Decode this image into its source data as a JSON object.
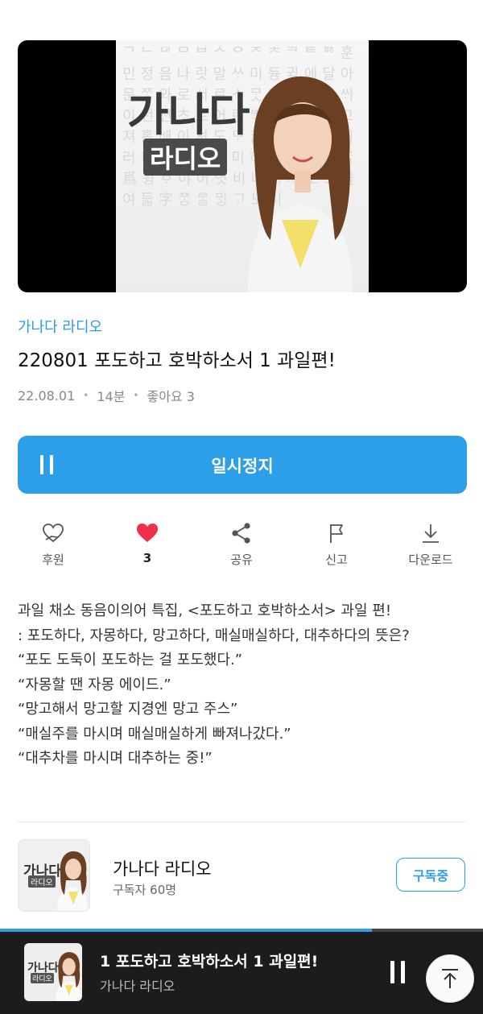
{
  "episode": {
    "artwork": {
      "title": "가나다",
      "subtitle": "라디오"
    },
    "channel_link": "가나다 라디오",
    "title": "220801 포도하고 호박하소서 1 과일편!",
    "date": "22.08.01",
    "duration": "14분",
    "likes_text": "좋아요 3"
  },
  "play_button": {
    "label": "일시정지",
    "icon": "pause-icon"
  },
  "actions": [
    {
      "label": "후원",
      "icon": "donate-heart-hand-icon"
    },
    {
      "label": "3",
      "icon": "heart-filled-icon"
    },
    {
      "label": "공유",
      "icon": "share-icon"
    },
    {
      "label": "신고",
      "icon": "flag-icon"
    },
    {
      "label": "다운로드",
      "icon": "download-icon"
    }
  ],
  "description": [
    "과일 채소 동음이의어 특집, <포도하고 호박하소서> 과일 편!",
    ":  포도하다, 자몽하다, 망고하다, 매실매실하다, 대추하다의 뜻은?",
    "“포도 도둑이 포도하는 걸 포도했다.”",
    "“자몽할 땐 자몽 에이드.”",
    "“망고해서 망고할 지경엔 망고 주스”",
    "“매실주를 마시며 매실매실하게 빠져나갔다.”",
    "“대추차를 마시며 대추하는 중!”"
  ],
  "channel": {
    "thumb_title": "가나다",
    "thumb_subtitle": "라디오",
    "name": "가나다 라디오",
    "subscribers": "구독자 60명",
    "subscribe_label": "구독중"
  },
  "mini_player": {
    "title": "1 포도하고 호박하소서 1 과일편!",
    "channel": "가나다 라디오",
    "progress": 0.77,
    "thumb_title": "가나다",
    "thumb_subtitle": "라디오"
  },
  "colors": {
    "accent": "#2d9ee8",
    "heart": "#f0304a",
    "mini_bg": "#1c1c1c"
  }
}
